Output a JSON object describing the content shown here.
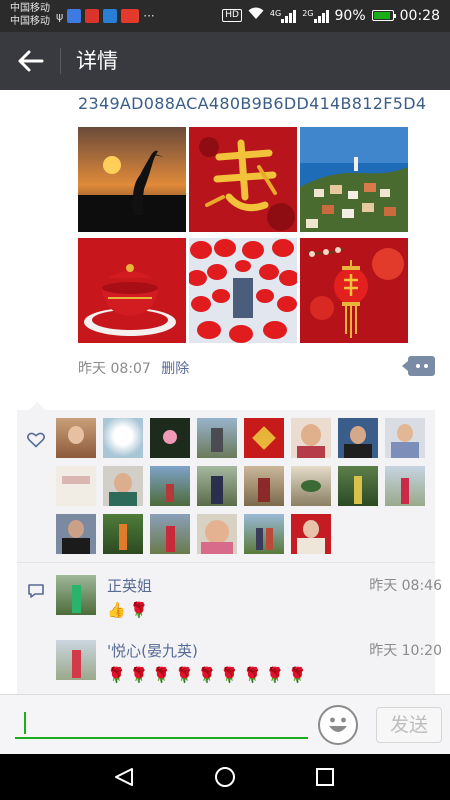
{
  "status_bar": {
    "carrier1": "中国移动",
    "carrier2": "中国移动",
    "hd_label": "HD",
    "net1": "4G",
    "net2": "2G",
    "battery": "90%",
    "time": "00:28",
    "more_icon": "···"
  },
  "header": {
    "title": "详情",
    "back_icon": "arrow-left-icon"
  },
  "post": {
    "text": "2349AD088ACA480B9B6DD414B812F5D4",
    "time": "昨天 08:07",
    "delete_label": "删除",
    "photo_count": 6
  },
  "likes": {
    "icon": "heart-outline-icon",
    "count": 21
  },
  "comments": [
    {
      "name": "正英姐",
      "time": "昨天 08:46",
      "text": "👍🌹"
    },
    {
      "name": "'悦心(晏九英)",
      "time": "昨天 10:20",
      "text": "🌹🌹🌹🌹🌹🌹🌹🌹🌹"
    }
  ],
  "input_bar": {
    "send_label": "发送",
    "emoji_icon": "smiley-face-icon"
  },
  "colors": {
    "status_bar_bg": "#2b2b2b",
    "title_bar_bg": "#393a3f",
    "link_blue": "#576b95",
    "accent_green": "#1aad19",
    "panel_bg": "#f3f3f5"
  }
}
